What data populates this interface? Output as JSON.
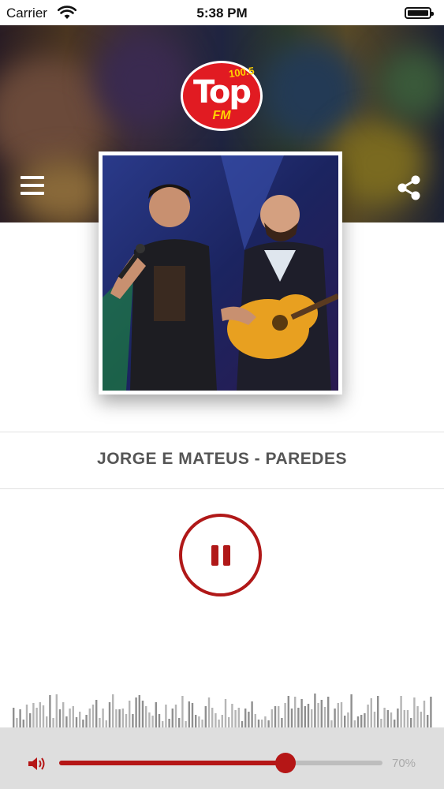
{
  "status_bar": {
    "carrier": "Carrier",
    "time": "5:38 PM"
  },
  "logo": {
    "frequency": "100.5",
    "name": "Top",
    "suffix": "FM"
  },
  "header": {
    "menu_icon": "hamburger-menu-icon",
    "share_icon": "share-icon"
  },
  "now_playing": {
    "title": "JORGE E MATEUS - PAREDES"
  },
  "player": {
    "state": "playing",
    "control_icon": "pause-icon"
  },
  "volume": {
    "level": 0.7,
    "label": "70%",
    "icon": "speaker-icon"
  },
  "colors": {
    "accent": "#b01818",
    "bottom_bar": "#dedede",
    "visualizer_bar": "#9a9a9a"
  }
}
